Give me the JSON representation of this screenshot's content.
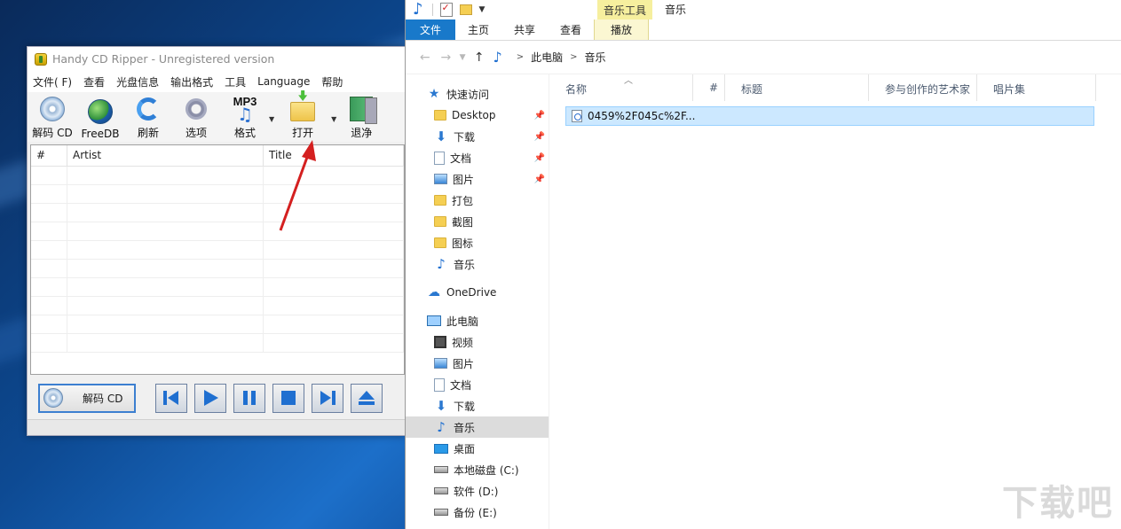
{
  "hcd": {
    "title": "Handy CD Ripper - Unregistered version",
    "menu": [
      "文件( F)",
      "查看",
      "光盘信息",
      "输出格式",
      "工具",
      "Language",
      "帮助"
    ],
    "toolbar": {
      "rip_label": "解码 CD",
      "freedb_label": "FreeDB",
      "refresh_label": "刷新",
      "options_label": "选项",
      "format_label": "格式",
      "format_badge": "MP3",
      "open_label": "打开",
      "exit_label": "退净"
    },
    "table": {
      "columns": [
        "#",
        "Artist",
        "Title"
      ],
      "rows": 10
    },
    "bottom": {
      "rip_button": "解码 CD"
    }
  },
  "explorer": {
    "context_group": "音乐工具",
    "window_title": "音乐",
    "ribbon_tabs": [
      "文件",
      "主页",
      "共享",
      "查看",
      "播放"
    ],
    "breadcrumb": [
      "此电脑",
      "音乐"
    ],
    "nav": {
      "quick_access": "快速访问",
      "quick_items": [
        {
          "label": "Desktop",
          "icon": "folder-icon",
          "pinned": true
        },
        {
          "label": "下载",
          "icon": "download-icon",
          "pinned": true
        },
        {
          "label": "文档",
          "icon": "document-icon",
          "pinned": true
        },
        {
          "label": "图片",
          "icon": "picture-icon",
          "pinned": true
        },
        {
          "label": "打包",
          "icon": "folder-icon",
          "pinned": false
        },
        {
          "label": "截图",
          "icon": "folder-icon",
          "pinned": false
        },
        {
          "label": "图标",
          "icon": "folder-icon",
          "pinned": false
        },
        {
          "label": "音乐",
          "icon": "music-icon",
          "pinned": false
        }
      ],
      "onedrive": "OneDrive",
      "this_pc": "此电脑",
      "pc_items": [
        {
          "label": "视频",
          "icon": "video-icon"
        },
        {
          "label": "图片",
          "icon": "picture-icon"
        },
        {
          "label": "文档",
          "icon": "document-icon"
        },
        {
          "label": "下载",
          "icon": "download-icon"
        },
        {
          "label": "音乐",
          "icon": "music-icon",
          "selected": true
        },
        {
          "label": "桌面",
          "icon": "desktop-icon"
        },
        {
          "label": "本地磁盘 (C:)",
          "icon": "drive-icon"
        },
        {
          "label": "软件 (D:)",
          "icon": "drive-icon"
        },
        {
          "label": "备份 (E:)",
          "icon": "drive-icon"
        }
      ]
    },
    "columns": [
      "名称",
      "#",
      "标题",
      "参与创作的艺术家",
      "唱片集"
    ],
    "files": [
      "0459%2F045c%2F..."
    ]
  },
  "watermark": "下载吧"
}
